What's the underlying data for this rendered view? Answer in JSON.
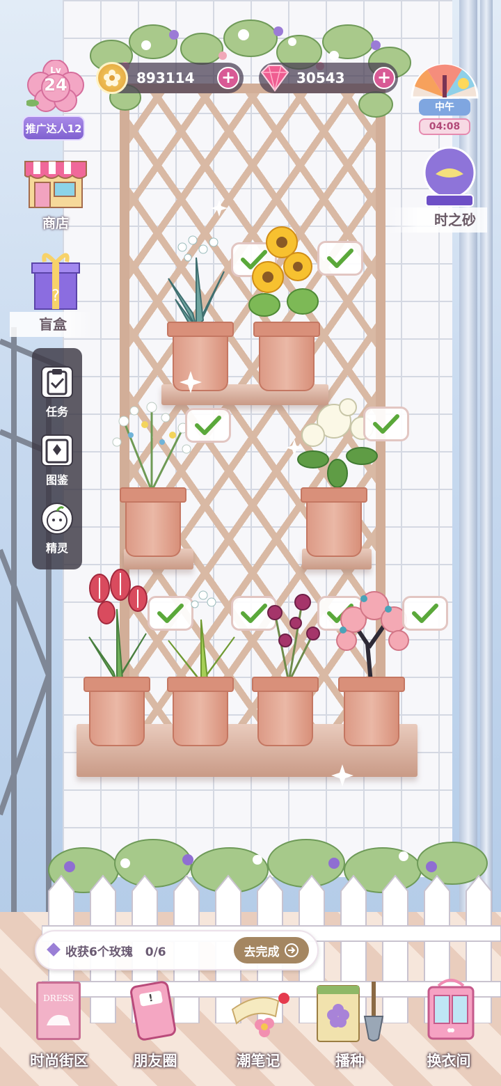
{
  "player": {
    "level_prefix": "Lv",
    "level": "24",
    "title_badge": "推广达人12"
  },
  "resources": {
    "coins": "893114",
    "gems": "30543"
  },
  "time_widget": {
    "period": "中午",
    "clock": "04:08"
  },
  "right_menu": {
    "hourglass_label": "时之砂"
  },
  "left_menu": {
    "shop_label": "商店",
    "blindbox_label": "盲盒"
  },
  "side_menu": [
    {
      "label": "任务",
      "icon": "clipboard-check-icon"
    },
    {
      "label": "图鉴",
      "icon": "card-book-icon"
    },
    {
      "label": "精灵",
      "icon": "sprite-icon"
    }
  ],
  "task": {
    "text": "收获6个玫瑰",
    "progress": "0/6",
    "progress_fraction": 0.0,
    "button_label": "去完成"
  },
  "bottom_nav": [
    {
      "label": "时尚街区",
      "icon": "dress-card-icon",
      "icon_text": "DRESS"
    },
    {
      "label": "朋友圈",
      "icon": "phone-icon"
    },
    {
      "label": "潮笔记",
      "icon": "note-flower-icon"
    },
    {
      "label": "播种",
      "icon": "seed-packet-icon"
    },
    {
      "label": "换衣间",
      "icon": "wardrobe-icon"
    }
  ],
  "plants": [
    {
      "name": "lily-of-valley",
      "shelf": 1,
      "harvest_ready": true
    },
    {
      "name": "sunflower",
      "shelf": 1,
      "harvest_ready": true
    },
    {
      "name": "babys-breath",
      "shelf": 2,
      "harvest_ready": true
    },
    {
      "name": "gardenia",
      "shelf": 2,
      "harvest_ready": true
    },
    {
      "name": "tulip",
      "shelf": 3,
      "harvest_ready": true
    },
    {
      "name": "lily-of-valley-2",
      "shelf": 3,
      "harvest_ready": true
    },
    {
      "name": "orchid",
      "shelf": 3,
      "harvest_ready": true
    },
    {
      "name": "cherry-blossom-tree",
      "shelf": 3,
      "harvest_ready": true
    }
  ],
  "colors": {
    "accent_pink": "#d85a95",
    "badge_purple": "#8c6fd8",
    "go_button": "#a48661",
    "check_green": "#5aa83a"
  }
}
